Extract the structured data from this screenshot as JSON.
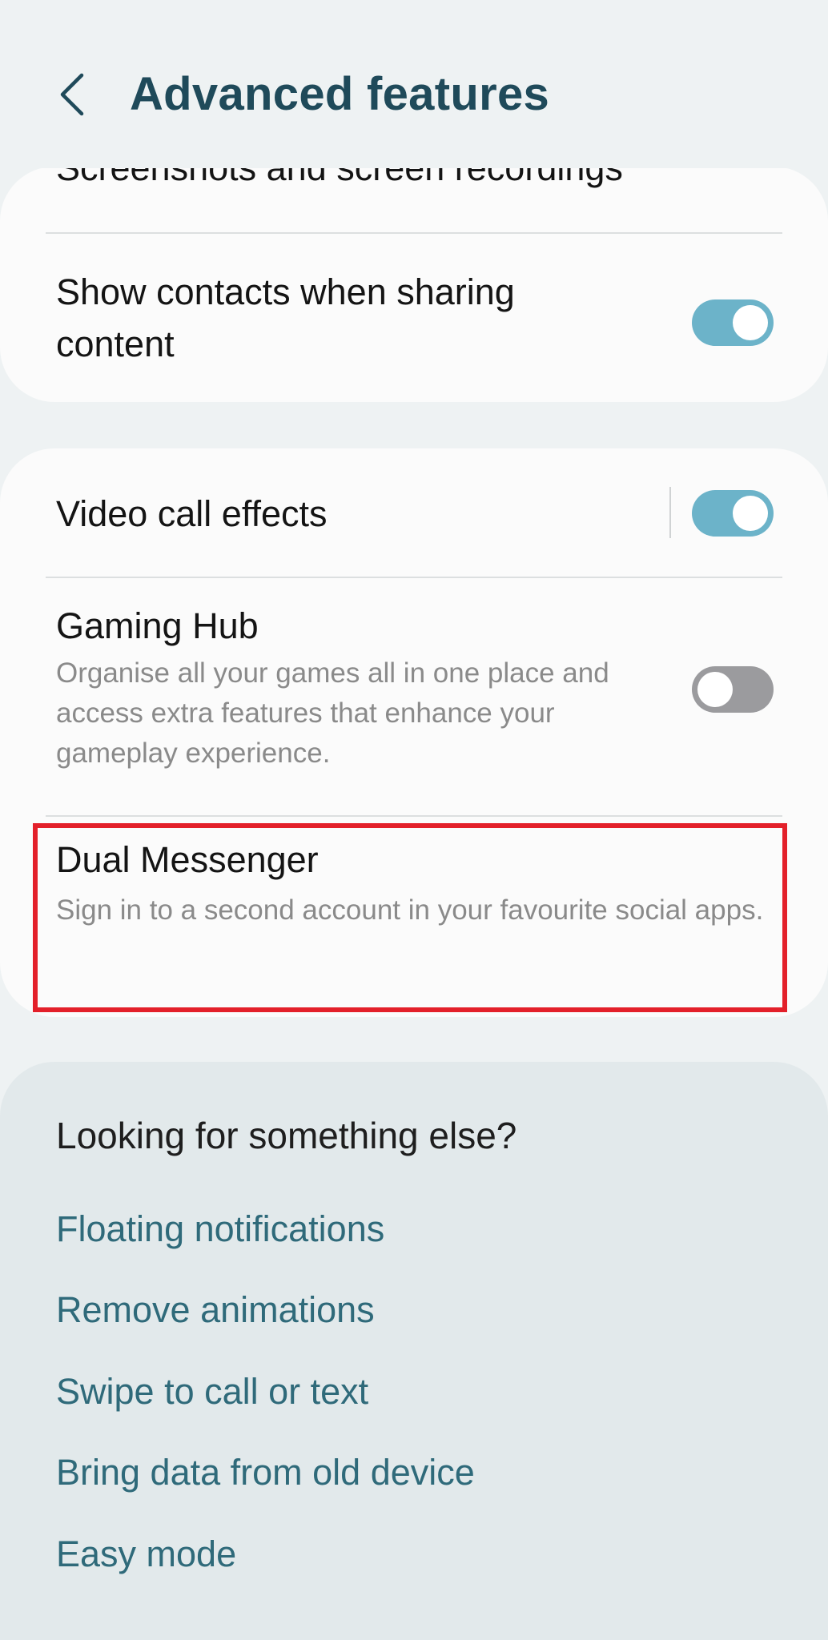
{
  "header": {
    "title": "Advanced features",
    "back_icon": "chevron-left-icon"
  },
  "card1": {
    "partial_item_label": "Screenshots and screen recordings",
    "show_contacts": {
      "label_line1": "Show contacts when sharing",
      "label_line2": "content",
      "enabled": true
    }
  },
  "card2": {
    "video_call_effects": {
      "label": "Video call effects",
      "enabled": true
    },
    "gaming_hub": {
      "label": "Gaming Hub",
      "description": "Organise all your games all in one place and access extra features that enhance your gameplay experience.",
      "enabled": false
    },
    "dual_messenger": {
      "label": "Dual Messenger",
      "description": "Sign in to a second account in your favourite social apps."
    }
  },
  "suggestions": {
    "title": "Looking for something else?",
    "links": [
      "Floating notifications",
      "Remove animations",
      "Swipe to call or text",
      "Bring data from old device",
      "Easy mode"
    ]
  },
  "colors": {
    "accent": "#6cb3c9",
    "title": "#1f4a5a",
    "link": "#2f6a7a",
    "highlight": "#e3202a"
  }
}
